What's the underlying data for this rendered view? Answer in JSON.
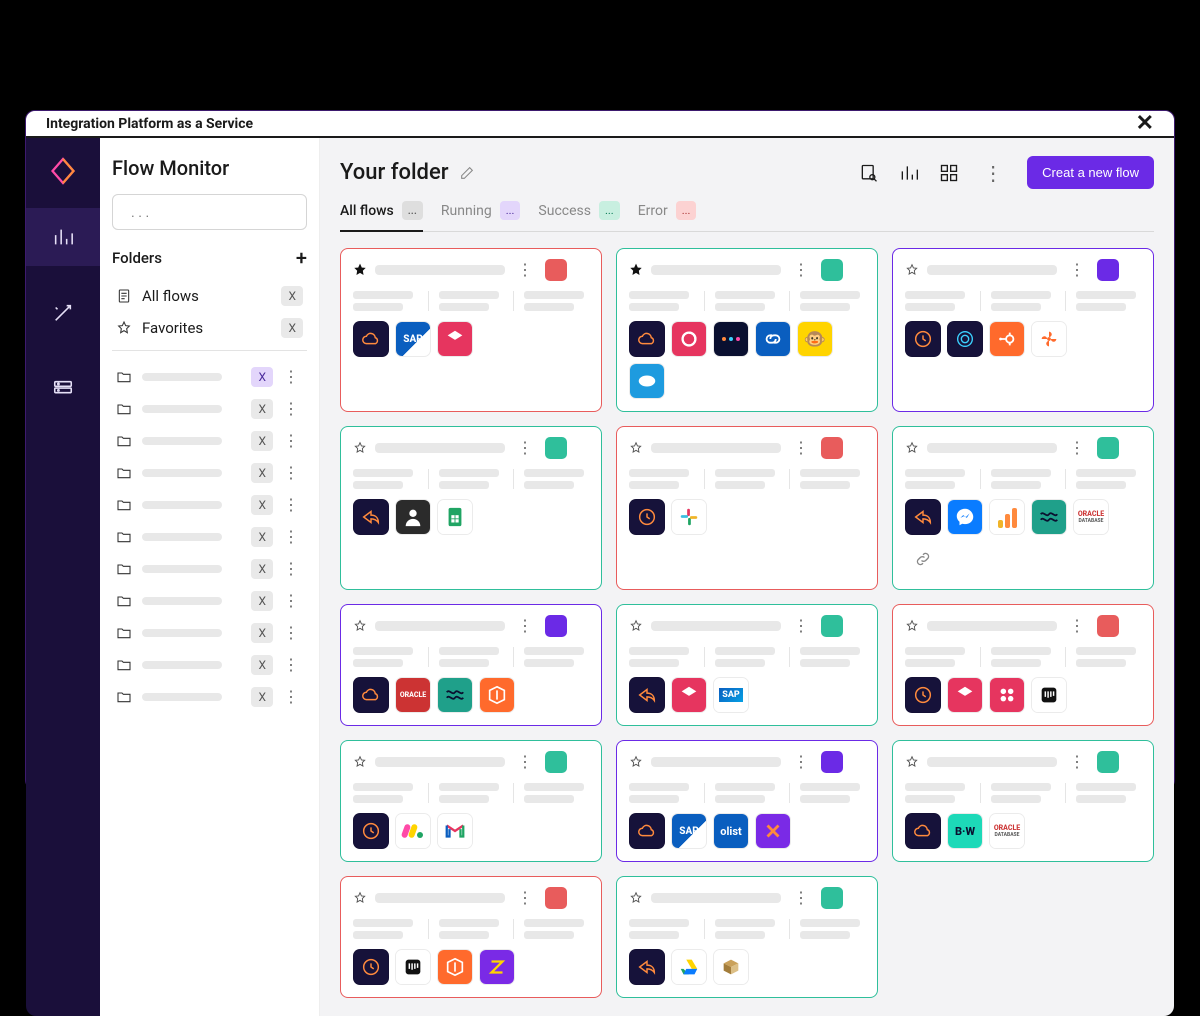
{
  "window": {
    "title": "Integration Platform as a Service",
    "close": "✕"
  },
  "navrail": {
    "items": [
      "brand",
      "chart",
      "wand",
      "db"
    ]
  },
  "sidebar": {
    "title": "Flow Monitor",
    "search_placeholder": ". . .",
    "folders_heading": "Folders",
    "all_flows_label": "All flows",
    "favorites_label": "Favorites",
    "badge_text": "X",
    "folder_count": 11
  },
  "main": {
    "title": "Your folder",
    "cta": "Creat a new flow",
    "tabs": [
      {
        "label": "All flows",
        "chip": "...",
        "variant": "gray",
        "active": true
      },
      {
        "label": "Running",
        "chip": "...",
        "variant": "purple"
      },
      {
        "label": "Success",
        "chip": "...",
        "variant": "green"
      },
      {
        "label": "Error",
        "chip": "...",
        "variant": "red"
      }
    ],
    "cards": [
      {
        "border": "red",
        "status": "red",
        "fav": true,
        "apps": [
          "cloud",
          "sap",
          "wetrans"
        ]
      },
      {
        "border": "green",
        "status": "green",
        "fav": true,
        "apps": [
          "cloud",
          "pink-ring",
          "navy-dots",
          "chain",
          "mailchimp",
          "salesforce"
        ]
      },
      {
        "border": "purple",
        "status": "purple",
        "fav": false,
        "apps": [
          "clock",
          "ibm",
          "hubspot",
          "fan"
        ]
      },
      {
        "border": "green",
        "status": "green",
        "fav": false,
        "apps": [
          "share",
          "portrait",
          "sheets"
        ]
      },
      {
        "border": "red",
        "status": "red",
        "fav": false,
        "apps": [
          "clock",
          "slack"
        ]
      },
      {
        "border": "green",
        "status": "green",
        "fav": false,
        "apps": [
          "share",
          "messenger",
          "ga",
          "wavy",
          "oracle"
        ],
        "extra_link": true
      },
      {
        "border": "purple",
        "status": "purple",
        "fav": false,
        "apps": [
          "cloud",
          "oracle-solid",
          "wavy",
          "magento"
        ]
      },
      {
        "border": "green",
        "status": "green",
        "fav": false,
        "apps": [
          "share",
          "wetrans",
          "sap-white"
        ]
      },
      {
        "border": "red",
        "status": "red",
        "fav": false,
        "apps": [
          "clock",
          "wetrans",
          "pink-dots",
          "intercom"
        ]
      },
      {
        "border": "green",
        "status": "green",
        "fav": false,
        "apps": [
          "clock",
          "monday",
          "gmail"
        ]
      },
      {
        "border": "purple",
        "status": "purple",
        "fav": false,
        "apps": [
          "cloud",
          "sap",
          "olist",
          "purple-x"
        ]
      },
      {
        "border": "green",
        "status": "green",
        "fav": false,
        "apps": [
          "cloud",
          "bw",
          "oracle"
        ]
      },
      {
        "border": "red",
        "status": "red",
        "fav": false,
        "apps": [
          "clock",
          "intercom",
          "magento",
          "purple-z"
        ]
      },
      {
        "border": "green",
        "status": "green",
        "fav": false,
        "apps": [
          "share",
          "gdrive",
          "box"
        ]
      }
    ]
  }
}
